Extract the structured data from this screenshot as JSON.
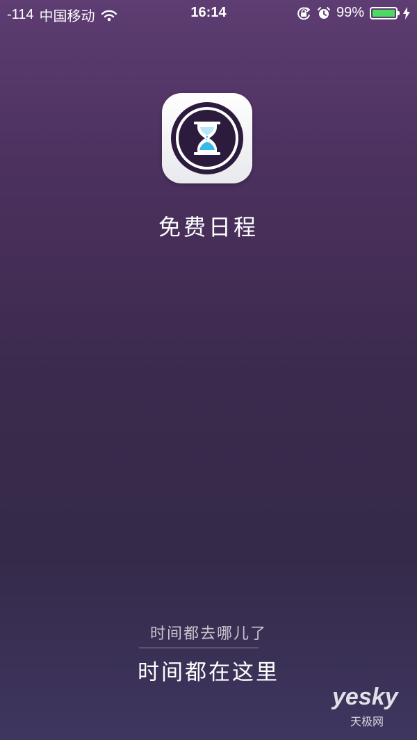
{
  "status_bar": {
    "signal": "-114",
    "carrier": "中国移动",
    "time": "16:14",
    "battery_percent": "99%",
    "battery_level": 0.99,
    "battery_color": "#4cd964",
    "icons": [
      "wifi-icon",
      "rotation-lock-icon",
      "alarm-icon",
      "battery-icon",
      "charging-icon"
    ]
  },
  "app": {
    "icon": "hourglass-icon",
    "name": "免费日程"
  },
  "tagline": {
    "question": "时间都去哪儿了",
    "answer": "时间都在这里"
  },
  "watermark": {
    "brand": "yesky",
    "subtitle": "天极网"
  },
  "colors": {
    "background_top": "#5e3d72",
    "background_bottom": "#3f3660",
    "icon_ring": "#2d1b3d",
    "hourglass_sand": "#37b8e8"
  }
}
